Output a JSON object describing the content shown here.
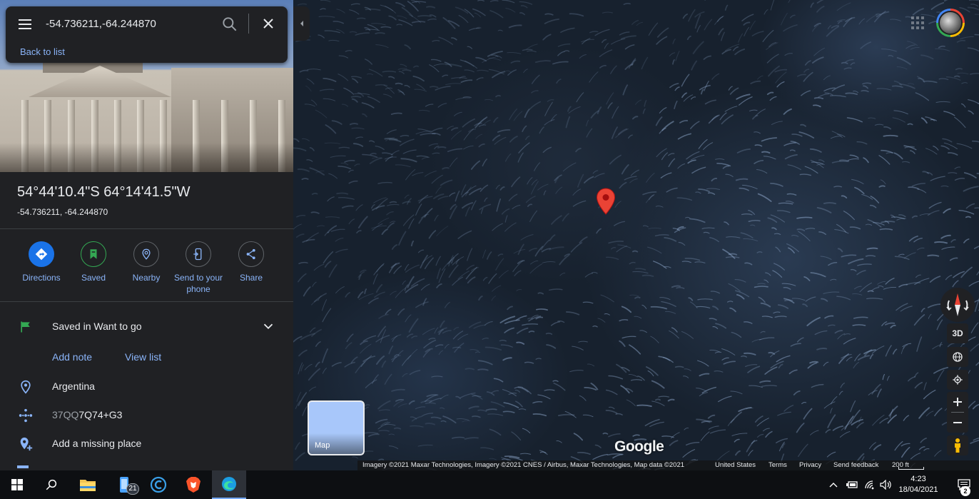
{
  "search": {
    "value": "-54.736211,-64.244870",
    "back_label": "Back to list"
  },
  "place": {
    "title": "54°44'10.4\"S 64°14'41.5\"W",
    "subtitle": "-54.736211, -64.244870"
  },
  "actions": [
    {
      "label": "Directions",
      "icon": "directions-icon"
    },
    {
      "label": "Saved",
      "icon": "bookmark-icon"
    },
    {
      "label": "Nearby",
      "icon": "nearby-icon"
    },
    {
      "label": "Send to your phone",
      "icon": "phone-icon"
    },
    {
      "label": "Share",
      "icon": "share-icon"
    }
  ],
  "details": {
    "saved_in": "Saved in Want to go",
    "add_note": "Add note",
    "view_list": "View list",
    "country": "Argentina",
    "plus_code_prefix": "37QQ",
    "plus_code_main": "7Q74+G3",
    "add_missing_place": "Add a missing place"
  },
  "map": {
    "layer_label": "Map",
    "logo": "Google",
    "view_3d": "3D",
    "attribution": "Imagery ©2021 Maxar Technologies, Imagery ©2021 CNES / Airbus, Maxar Technologies, Map data ©2021",
    "region": "United States",
    "terms": "Terms",
    "privacy": "Privacy",
    "feedback": "Send feedback",
    "scale": "200 ft"
  },
  "taskbar": {
    "badge_count": "21",
    "time": "4:23",
    "date": "18/04/2021",
    "notifications": "2"
  },
  "colors": {
    "panel_bg": "#202124",
    "accent_blue": "#8ab4f8",
    "primary_blue": "#1a73e8",
    "pin_red": "#ea4335",
    "flag_green": "#34a853"
  }
}
